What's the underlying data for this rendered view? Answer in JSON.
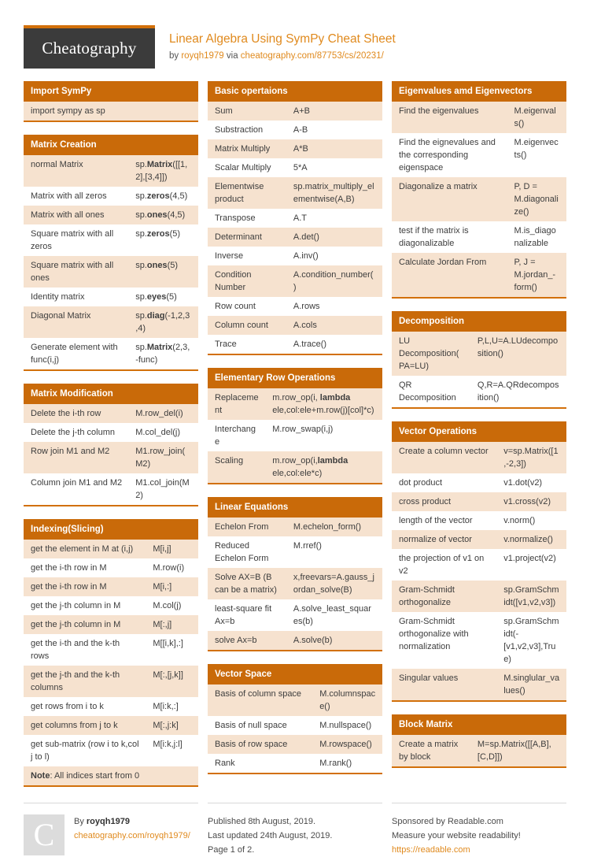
{
  "header": {
    "logo_text": "Cheatography",
    "title": "Linear Algebra Using SymPy Cheat Sheet",
    "by_prefix": "by ",
    "author": "royqh1979",
    "via": " via ",
    "source_url": "cheatography.com/87753/cs/20231/"
  },
  "columns": [
    {
      "cards": [
        {
          "title": "Import SymPy",
          "layout": "full",
          "rows": [
            {
              "cells": [
                "import sympy as sp"
              ]
            }
          ]
        },
        {
          "title": "Matrix Creation",
          "layout": "split-60",
          "rows": [
            {
              "cells": [
                "normal Matrix",
                "sp.<b>Matrix</b>([[1,2],[3,4]])"
              ]
            },
            {
              "cells": [
                "Matrix with all zeros",
                "sp.<b>zeros</b>(4,5)"
              ]
            },
            {
              "cells": [
                "Matrix with all ones",
                "sp.<b>ones</b>(4,5)"
              ]
            },
            {
              "cells": [
                "Square matrix with all zeros",
                "sp.<b>zeros</b>(5)"
              ]
            },
            {
              "cells": [
                "Square matrix with all ones",
                "sp.<b>ones</b>(5)"
              ]
            },
            {
              "cells": [
                "Identity matrix",
                "sp.<b>eyes</b>(5)"
              ]
            },
            {
              "cells": [
                "Diagonal Matrix",
                "sp.<b>diag</b>(-1,2,3,4)"
              ]
            },
            {
              "cells": [
                "Generate element with func(i,j)",
                "sp.<b>Matrix</b>(2,3,-func)"
              ]
            }
          ]
        },
        {
          "title": "Matrix Modification",
          "layout": "split-60",
          "rows": [
            {
              "cells": [
                "Delete the i-th row",
                "M.row_del(i)"
              ]
            },
            {
              "cells": [
                "Delete the j-th column",
                "M.col_del(j)"
              ]
            },
            {
              "cells": [
                "Row join M1 and M2",
                "M1.row_join(M2)"
              ]
            },
            {
              "cells": [
                "Column join M1 and M2",
                "M1.col_join(M2)"
              ]
            }
          ]
        },
        {
          "title": "Indexing(Slicing)",
          "layout": "split-70",
          "rows": [
            {
              "cells": [
                "get the element in M at (i,j)",
                "M[i,j]"
              ]
            },
            {
              "cells": [
                "get the i-th row in M",
                "M.row(i)"
              ]
            },
            {
              "cells": [
                "get the i-th row in M",
                "M[i,:]"
              ]
            },
            {
              "cells": [
                "get the j-th column in M",
                "M.col(j)"
              ]
            },
            {
              "cells": [
                "get the j-th column in M",
                "M[:,j]"
              ]
            },
            {
              "cells": [
                "get the i-th and the k-th rows",
                "M[[i,k],:]"
              ]
            },
            {
              "cells": [
                "get the j-th and the k-th columns",
                "M[:,[j,k]]"
              ]
            },
            {
              "cells": [
                "get rows from i to k",
                "M[i:k,:]"
              ]
            },
            {
              "cells": [
                "get columns from j to k",
                "M[:,j:k]"
              ]
            },
            {
              "cells": [
                "get sub-matrix (row i to k,col j to l)",
                "M[i:k,j:l]"
              ]
            },
            {
              "cells": [
                "<b>Note</b>: All indices start from 0"
              ],
              "note": true
            }
          ]
        }
      ]
    },
    {
      "cards": [
        {
          "title": "Basic opertaions",
          "layout": "split-45",
          "rows": [
            {
              "cells": [
                "Sum",
                "A+B"
              ]
            },
            {
              "cells": [
                "Substraction",
                "A-B"
              ]
            },
            {
              "cells": [
                "Matrix Multiply",
                "A*B"
              ]
            },
            {
              "cells": [
                "Scalar Multiply",
                "5*A"
              ]
            },
            {
              "cells": [
                "Elementwise product",
                "sp.matrix_multiply_elementwise(A,B)"
              ]
            },
            {
              "cells": [
                "Transpose",
                "A.T"
              ]
            },
            {
              "cells": [
                "Determinant",
                "A.det()"
              ]
            },
            {
              "cells": [
                "Inverse",
                "A.inv()"
              ]
            },
            {
              "cells": [
                "Condition Number",
                "A.condition_number()"
              ]
            },
            {
              "cells": [
                "Row count",
                "A.rows"
              ]
            },
            {
              "cells": [
                "Column count",
                "A.cols"
              ]
            },
            {
              "cells": [
                "Trace",
                "A.trace()"
              ]
            }
          ]
        },
        {
          "title": "Elementary Row Operations",
          "layout": "split-33",
          "rows": [
            {
              "cells": [
                "Replacement",
                "m.row_op(i, <b>lambda</b> ele,col:ele+m.row(j)[col]*c)"
              ]
            },
            {
              "cells": [
                "Interchange",
                "M.row_swap(i,j)"
              ]
            },
            {
              "cells": [
                "Scaling",
                "m.row_op(i,<b>lambda</b> ele,col:ele*c)"
              ]
            }
          ]
        },
        {
          "title": "Linear Equations",
          "layout": "split-45",
          "rows": [
            {
              "cells": [
                "Echelon From",
                "M.echelon_form()"
              ]
            },
            {
              "cells": [
                "Reduced Echelon Form",
                "M.rref()"
              ]
            },
            {
              "cells": [
                "Solve AX=B (B can be a matrix)",
                "x,freevars=A.gauss_jordan_solve(B)"
              ]
            },
            {
              "cells": [
                "least-square fit Ax=b",
                "A.solve_least_squares(b)"
              ]
            },
            {
              "cells": [
                "solve Ax=b",
                "A.solve(b)"
              ]
            }
          ]
        },
        {
          "title": "Vector Space",
          "layout": "split-60",
          "rows": [
            {
              "cells": [
                "Basis of column space",
                "M.columnspace()"
              ]
            },
            {
              "cells": [
                "Basis of null space",
                "M.nullspace()"
              ]
            },
            {
              "cells": [
                "Basis of row space",
                "M.rowspace()"
              ]
            },
            {
              "cells": [
                "Rank",
                "M.rank()"
              ]
            }
          ]
        }
      ]
    },
    {
      "cards": [
        {
          "title": "Eigenvalues amd Eigenvectors",
          "layout": "split-66",
          "rows": [
            {
              "cells": [
                "Find the eigenvalues",
                "M.eigenvals()"
              ]
            },
            {
              "cells": [
                "Find the eignevalues and the corresponding eigenspace",
                "M.eigenvects()"
              ]
            },
            {
              "cells": [
                "Diagonalize a matrix",
                "P, D = M.diagonalize()"
              ]
            },
            {
              "cells": [
                "test if the matrix is diagonalizable",
                "M.is_diagonalizable"
              ]
            },
            {
              "cells": [
                "Calculate Jordan From",
                "P, J = M.jordan_-form()"
              ]
            }
          ]
        },
        {
          "title": "Decomposition",
          "layout": "split-45",
          "rows": [
            {
              "cells": [
                "LU Decomposition(PA=LU)",
                "P,L,U=A.LUdecomposition()"
              ]
            },
            {
              "cells": [
                "QR Decomposition",
                "Q,R=A.QRdecomposition()"
              ]
            }
          ]
        },
        {
          "title": "Vector Operations",
          "layout": "split-60",
          "rows": [
            {
              "cells": [
                "Create a column vector",
                "v=sp.Matrix([1,-2,3])"
              ]
            },
            {
              "cells": [
                "dot product",
                "v1.dot(v2)"
              ]
            },
            {
              "cells": [
                "cross product",
                "v1.cross(v2)"
              ]
            },
            {
              "cells": [
                "length of the vector",
                "v.norm()"
              ]
            },
            {
              "cells": [
                "normalize of vector",
                "v.normalize()"
              ]
            },
            {
              "cells": [
                "the projection of v1 on v2",
                "v1.project(v2)"
              ]
            },
            {
              "cells": [
                "Gram-Schmidt orthogonalize",
                "sp.GramSchmidt([v1,v2,v3])"
              ]
            },
            {
              "cells": [
                "Gram-Schmidt orthogonalize with normalization",
                "sp.GramSchmidt(-[v1,v2,v3],True)"
              ]
            },
            {
              "cells": [
                "Singular values",
                "M.singlular_values()"
              ]
            }
          ]
        },
        {
          "title": "Block Matrix",
          "layout": "split-45",
          "rows": [
            {
              "cells": [
                "Create a matrix by block",
                "M=sp.Matrix([[A,B],[C,D]])"
              ]
            }
          ]
        }
      ]
    }
  ],
  "footer": {
    "avatar_letter": "C",
    "by_label": "By ",
    "author": "royqh1979",
    "author_url": "cheatography.com/royqh1979/",
    "published": "Published 8th August, 2019.",
    "updated": "Last updated 24th August, 2019.",
    "page": "Page 1 of 2.",
    "sponsor_prefix": "Sponsored by ",
    "sponsor_name": "Readable.com",
    "sponsor_tagline": "Measure your website readability!",
    "sponsor_url": "https://readable.com"
  }
}
